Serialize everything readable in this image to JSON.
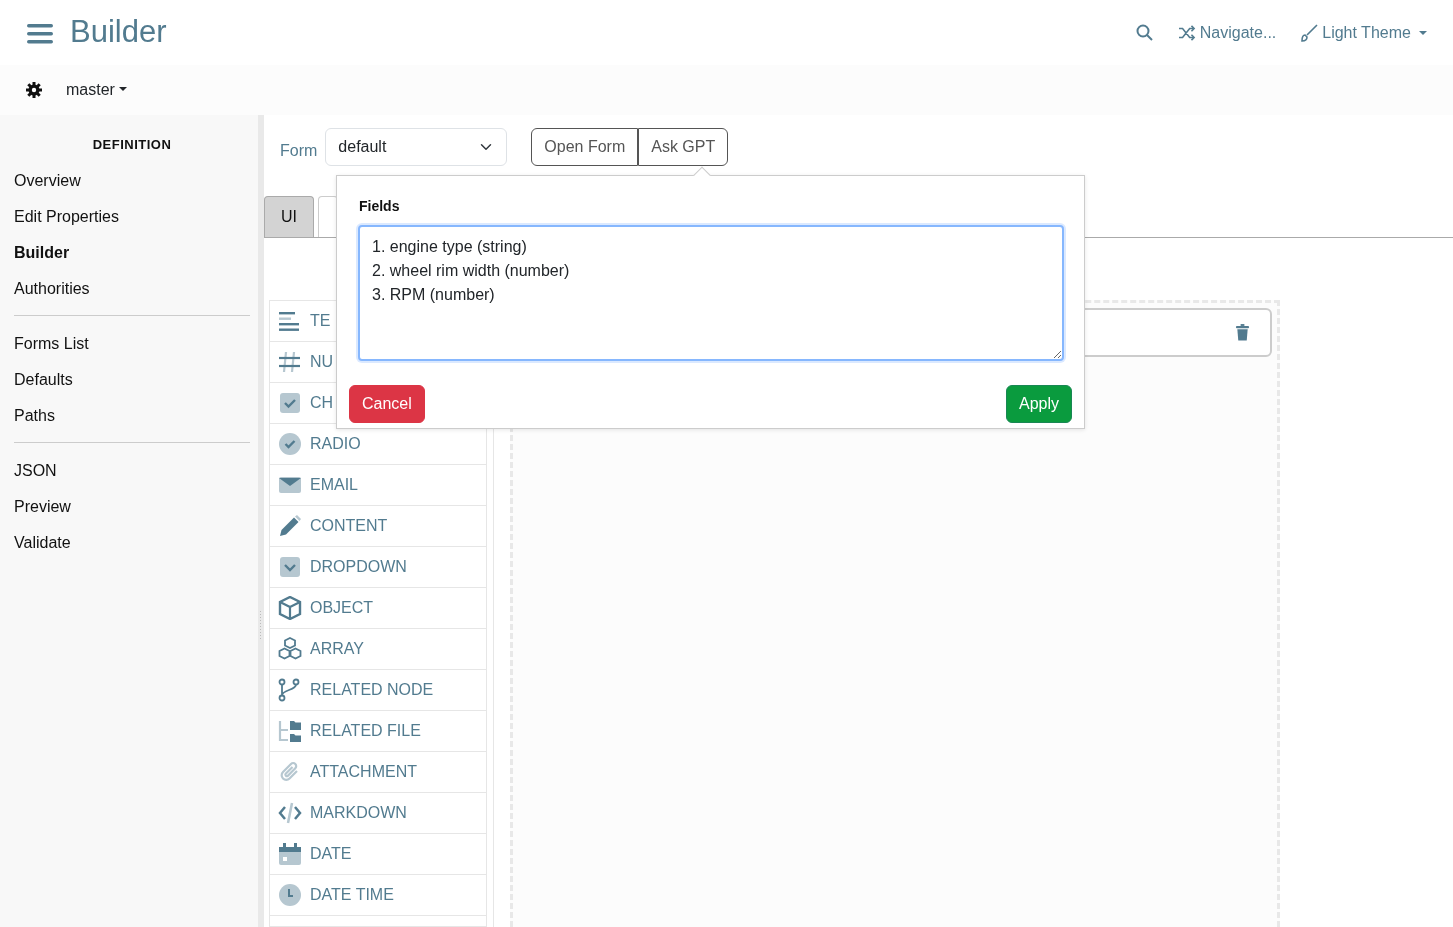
{
  "app": {
    "title": "Builder"
  },
  "topnav": {
    "navigate": "Navigate...",
    "theme": "Light Theme"
  },
  "branch": "master",
  "sidebar": {
    "heading": "DEFINITION",
    "groups": [
      [
        {
          "label": "Overview",
          "selected": false
        },
        {
          "label": "Edit Properties",
          "selected": false
        },
        {
          "label": "Builder",
          "selected": true
        },
        {
          "label": "Authorities",
          "selected": false
        }
      ],
      [
        {
          "label": "Forms List",
          "selected": false
        },
        {
          "label": "Defaults",
          "selected": false
        },
        {
          "label": "Paths",
          "selected": false
        }
      ],
      [
        {
          "label": "JSON",
          "selected": false
        },
        {
          "label": "Preview",
          "selected": false
        },
        {
          "label": "Validate",
          "selected": false
        }
      ]
    ]
  },
  "form_bar": {
    "label": "Form",
    "select_value": "default",
    "buttons": [
      "Open Form",
      "Ask GPT"
    ]
  },
  "tabs": [
    {
      "label": "UI",
      "selected": true
    }
  ],
  "palette": [
    {
      "kind": "text",
      "label": "TE"
    },
    {
      "kind": "number",
      "label": "NU"
    },
    {
      "kind": "checkbox",
      "label": "CH"
    },
    {
      "kind": "radio",
      "label": "RADIO"
    },
    {
      "kind": "email",
      "label": "EMAIL"
    },
    {
      "kind": "content",
      "label": "CONTENT"
    },
    {
      "kind": "dropdown",
      "label": "DROPDOWN"
    },
    {
      "kind": "object",
      "label": "OBJECT"
    },
    {
      "kind": "array",
      "label": "ARRAY"
    },
    {
      "kind": "node",
      "label": "RELATED NODE"
    },
    {
      "kind": "file",
      "label": "RELATED FILE"
    },
    {
      "kind": "attachment",
      "label": "ATTACHMENT"
    },
    {
      "kind": "markdown",
      "label": "MARKDOWN"
    },
    {
      "kind": "date",
      "label": "DATE"
    },
    {
      "kind": "datetime",
      "label": "DATE TIME"
    }
  ],
  "popover": {
    "label": "Fields",
    "value": "1. engine type (string)\n2. wheel rim width (number)\n3. RPM (number)",
    "cancel": "Cancel",
    "apply": "Apply"
  }
}
